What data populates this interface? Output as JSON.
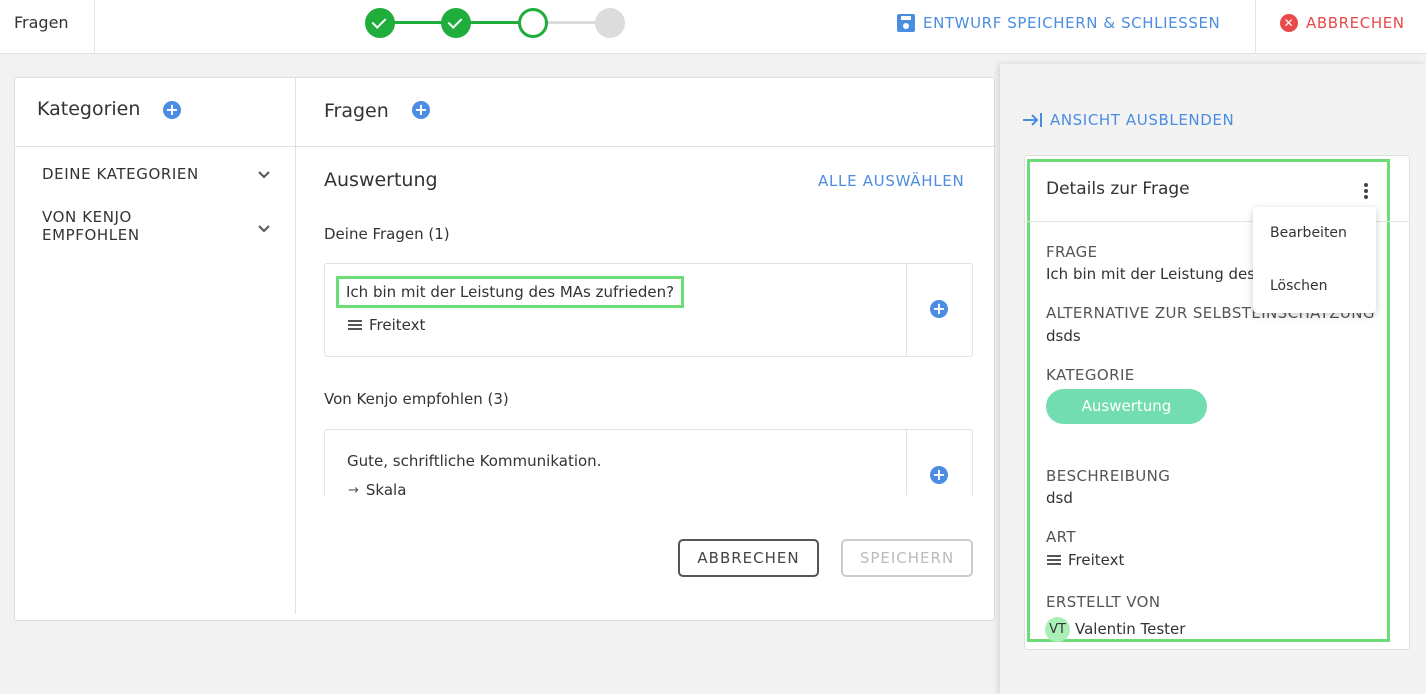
{
  "topbar": {
    "title": "Fragen",
    "save_label": "ENTWURF SPEICHERN & SCHLIESSEN",
    "cancel_label": "ABBRECHEN",
    "stepper": {
      "steps_total": 4,
      "completed": 2,
      "current": 3
    }
  },
  "categories": {
    "title": "Kategorien",
    "items": [
      {
        "label": "DEINE KATEGORIEN"
      },
      {
        "label": "VON KENJO EMPFOHLEN"
      }
    ]
  },
  "questions": {
    "title": "Fragen",
    "section_title": "Auswertung",
    "select_all_label": "ALLE AUSWÄHLEN",
    "groups": [
      {
        "label": "Deine Fragen (1)",
        "items": [
          {
            "text": "Ich bin mit der Leistung des MAs zufrieden?",
            "type": "Freitext",
            "type_icon": "lines-icon"
          }
        ]
      },
      {
        "label": "Von Kenjo empfohlen (3)",
        "items": [
          {
            "text": "Gute, schriftliche Kommunikation.",
            "type": "Skala",
            "type_icon": "arrow-right-icon"
          }
        ]
      }
    ],
    "cancel_button": "ABBRECHEN",
    "save_button": "SPEICHERN"
  },
  "side_panel": {
    "hide_label": "ANSICHT AUSBLENDEN",
    "detail": {
      "title": "Details zur Frage",
      "question_label": "FRAGE",
      "question_value": "Ich bin mit der Leistung des",
      "alt_label": "ALTERNATIVE ZUR SELBSTEINSCHÄTZUNG",
      "alt_value": "dsds",
      "category_label": "KATEGORIE",
      "category_value": "Auswertung",
      "desc_label": "BESCHREIBUNG",
      "desc_value": "dsd",
      "type_label": "ART",
      "type_value": "Freitext",
      "created_label": "ERSTELLT VON",
      "avatar_initials": "VT",
      "created_value": "Valentin Tester"
    },
    "menu": {
      "edit": "Bearbeiten",
      "delete": "Löschen"
    }
  },
  "colors": {
    "accent": "#4a8de2",
    "success": "#1fae3c",
    "danger": "#e84a4a",
    "category_pill": "#72ddb0",
    "highlight": "#6bdc78"
  }
}
